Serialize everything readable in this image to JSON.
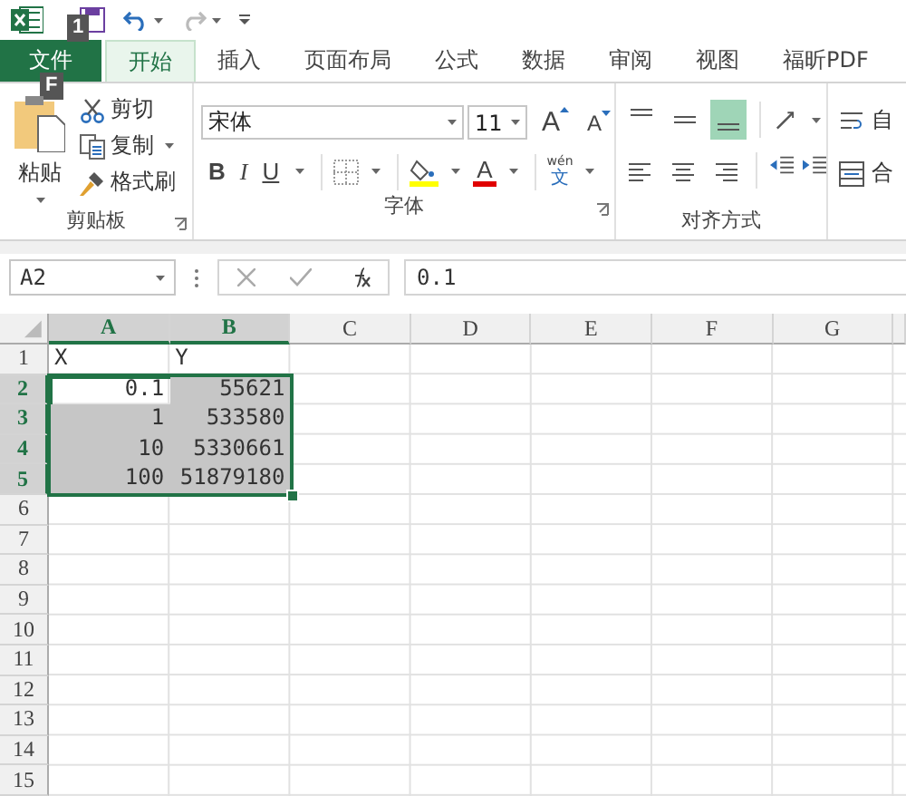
{
  "quick_access": {
    "keytip": "1"
  },
  "tabs": [
    {
      "label": "文件",
      "kind": "file",
      "selected": false,
      "keytip": "F"
    },
    {
      "label": "开始",
      "kind": "tab",
      "selected": true
    },
    {
      "label": "插入",
      "kind": "tab",
      "selected": false
    },
    {
      "label": "页面布局",
      "kind": "tab",
      "selected": false
    },
    {
      "label": "公式",
      "kind": "tab",
      "selected": false
    },
    {
      "label": "数据",
      "kind": "tab",
      "selected": false
    },
    {
      "label": "审阅",
      "kind": "tab",
      "selected": false
    },
    {
      "label": "视图",
      "kind": "tab",
      "selected": false
    },
    {
      "label": "福昕PDF",
      "kind": "tab",
      "selected": false
    }
  ],
  "clipboard": {
    "paste": "粘贴",
    "cut": "剪切",
    "copy": "复制",
    "format_painter": "格式刷",
    "label": "剪贴板"
  },
  "font": {
    "name": "宋体",
    "size": "11",
    "grow": "A",
    "shrink": "A",
    "bold": "B",
    "italic": "I",
    "underline": "U",
    "font_color": "A",
    "phonetic_top": "wén",
    "phonetic_bottom": "文",
    "label": "字体"
  },
  "alignment": {
    "vertical": [
      {
        "kind": "top",
        "selected": false
      },
      {
        "kind": "middle",
        "selected": false
      },
      {
        "kind": "bottom",
        "selected": true
      }
    ],
    "horizontal": [
      {
        "kind": "left",
        "selected": false
      },
      {
        "kind": "center",
        "selected": false
      },
      {
        "kind": "right",
        "selected": false
      }
    ],
    "wrap": "自",
    "merge": "合",
    "label": "对齐方式"
  },
  "formula_bar": {
    "name_box": "A2",
    "formula": "0.1"
  },
  "sheet": {
    "columns": [
      {
        "label": "A",
        "selected": true
      },
      {
        "label": "B",
        "selected": true
      },
      {
        "label": "C",
        "selected": false
      },
      {
        "label": "D",
        "selected": false
      },
      {
        "label": "E",
        "selected": false
      },
      {
        "label": "F",
        "selected": false
      },
      {
        "label": "G",
        "selected": false
      }
    ],
    "rows": [
      {
        "label": "1",
        "selected": false,
        "cells": [
          {
            "value": "X",
            "kind": "text",
            "selected": false,
            "active": false
          },
          {
            "value": "Y",
            "kind": "text",
            "selected": false,
            "active": false
          }
        ]
      },
      {
        "label": "2",
        "selected": true,
        "cells": [
          {
            "value": "0.1",
            "kind": "number",
            "selected": true,
            "active": true
          },
          {
            "value": "55621",
            "kind": "number",
            "selected": true,
            "active": false
          }
        ]
      },
      {
        "label": "3",
        "selected": true,
        "cells": [
          {
            "value": "1",
            "kind": "number",
            "selected": true,
            "active": false
          },
          {
            "value": "533580",
            "kind": "number",
            "selected": true,
            "active": false
          }
        ]
      },
      {
        "label": "4",
        "selected": true,
        "cells": [
          {
            "value": "10",
            "kind": "number",
            "selected": true,
            "active": false
          },
          {
            "value": "5330661",
            "kind": "number",
            "selected": true,
            "active": false
          }
        ]
      },
      {
        "label": "5",
        "selected": true,
        "cells": [
          {
            "value": "100",
            "kind": "number",
            "selected": true,
            "active": false
          },
          {
            "value": "51879180",
            "kind": "number",
            "selected": true,
            "active": false
          }
        ]
      },
      {
        "label": "6",
        "selected": false,
        "cells": []
      },
      {
        "label": "7",
        "selected": false,
        "cells": []
      },
      {
        "label": "8",
        "selected": false,
        "cells": []
      },
      {
        "label": "9",
        "selected": false,
        "cells": []
      },
      {
        "label": "10",
        "selected": false,
        "cells": []
      },
      {
        "label": "11",
        "selected": false,
        "cells": []
      },
      {
        "label": "12",
        "selected": false,
        "cells": []
      },
      {
        "label": "13",
        "selected": false,
        "cells": []
      },
      {
        "label": "14",
        "selected": false,
        "cells": []
      },
      {
        "label": "15",
        "selected": false,
        "cells": []
      }
    ]
  }
}
